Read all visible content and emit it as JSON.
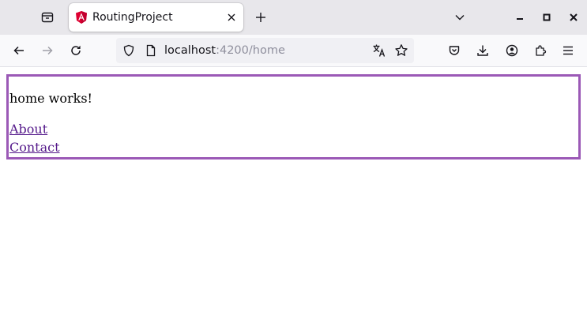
{
  "browser": {
    "tab": {
      "title": "RoutingProject"
    },
    "url": {
      "host": "localhost",
      "rest": ":4200/home"
    }
  },
  "page": {
    "message": "home works!",
    "links": [
      {
        "label": "About"
      },
      {
        "label": "Contact"
      }
    ]
  },
  "colors": {
    "content_border": "#9b59b6",
    "visited_link": "#551a8b",
    "angular_red": "#dd0031"
  }
}
